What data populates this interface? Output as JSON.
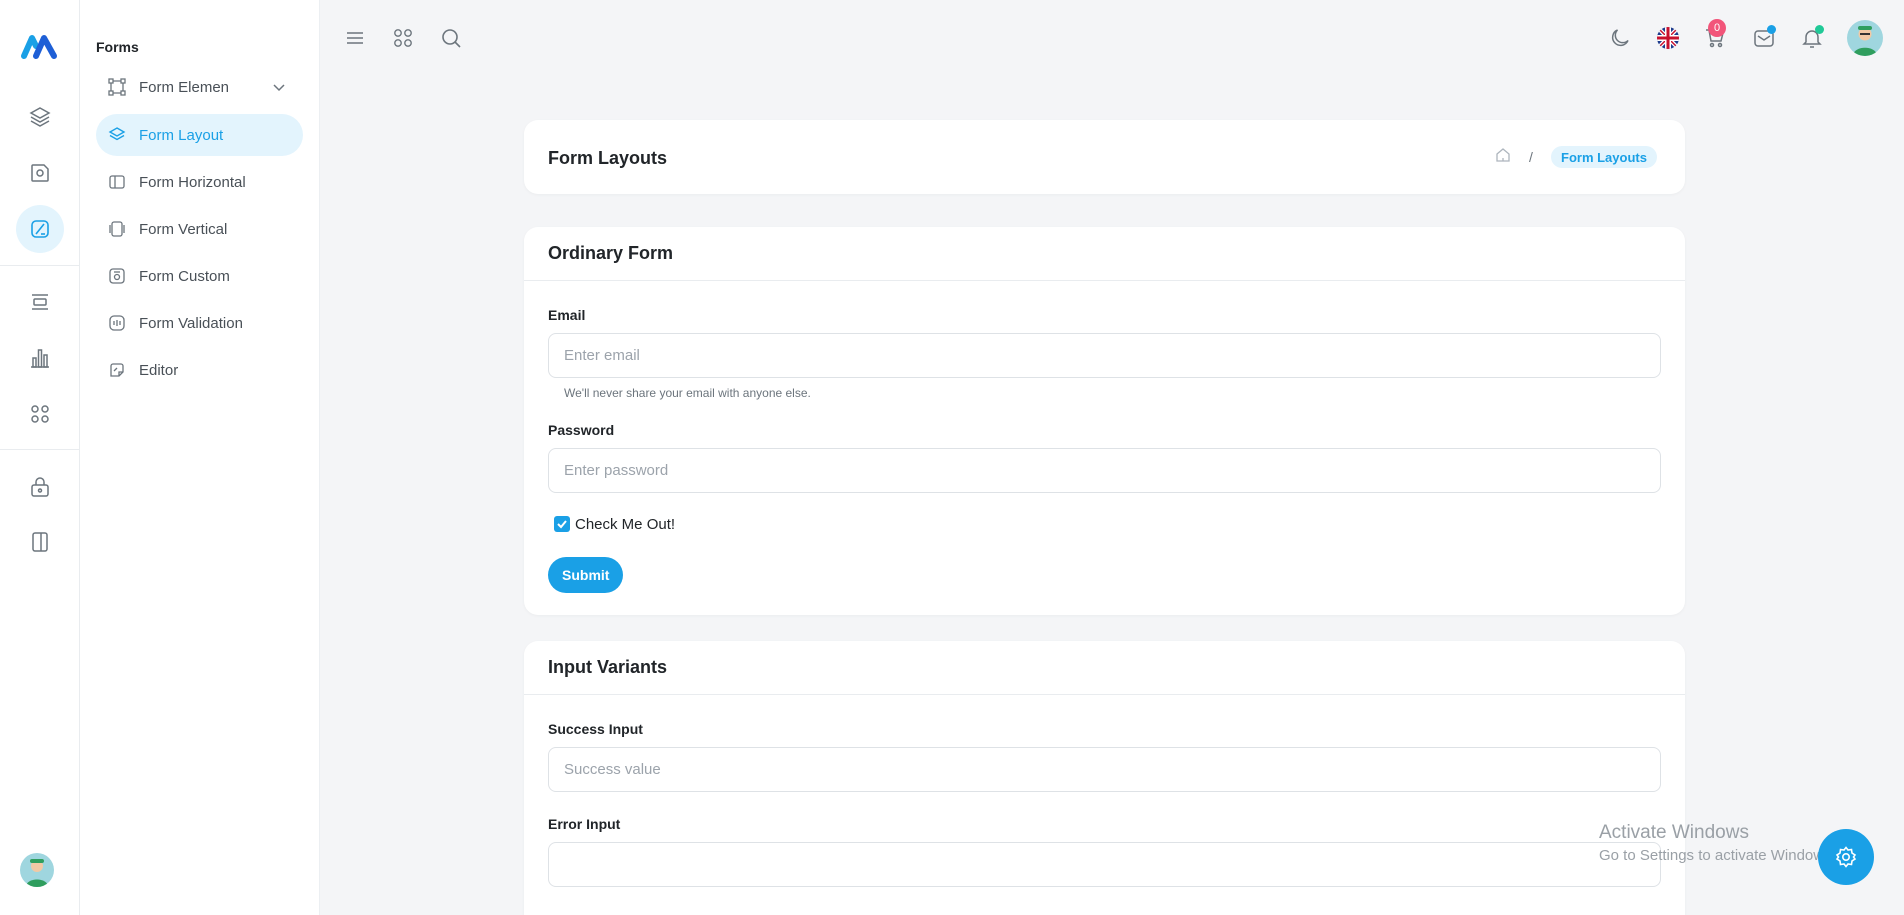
{
  "subnav": {
    "title": "Forms",
    "items": [
      {
        "label": "Form Elemen"
      },
      {
        "label": "Form Layout"
      },
      {
        "label": "Form Horizontal"
      },
      {
        "label": "Form Vertical"
      },
      {
        "label": "Form Custom"
      },
      {
        "label": "Form Validation"
      },
      {
        "label": "Editor"
      }
    ]
  },
  "topbar": {
    "cart_count": "0"
  },
  "page": {
    "title": "Form Layouts",
    "breadcrumb_sep": "/",
    "breadcrumb_current": "Form Layouts"
  },
  "ordinary_form": {
    "title": "Ordinary Form",
    "email_label": "Email",
    "email_placeholder": "Enter email",
    "email_help": "We'll never share your email with anyone else.",
    "password_label": "Password",
    "password_placeholder": "Enter password",
    "checkbox_label": "Check Me Out!",
    "submit_label": "Submit"
  },
  "input_variants": {
    "title": "Input Variants",
    "success_label": "Success Input",
    "success_placeholder": "Success value",
    "error_label": "Error Input"
  },
  "watermark": {
    "line1": "Activate Windows",
    "line2": "Go to Settings to activate Windows."
  },
  "colors": {
    "accent": "#1aa0e6",
    "badge": "#f2557a"
  }
}
